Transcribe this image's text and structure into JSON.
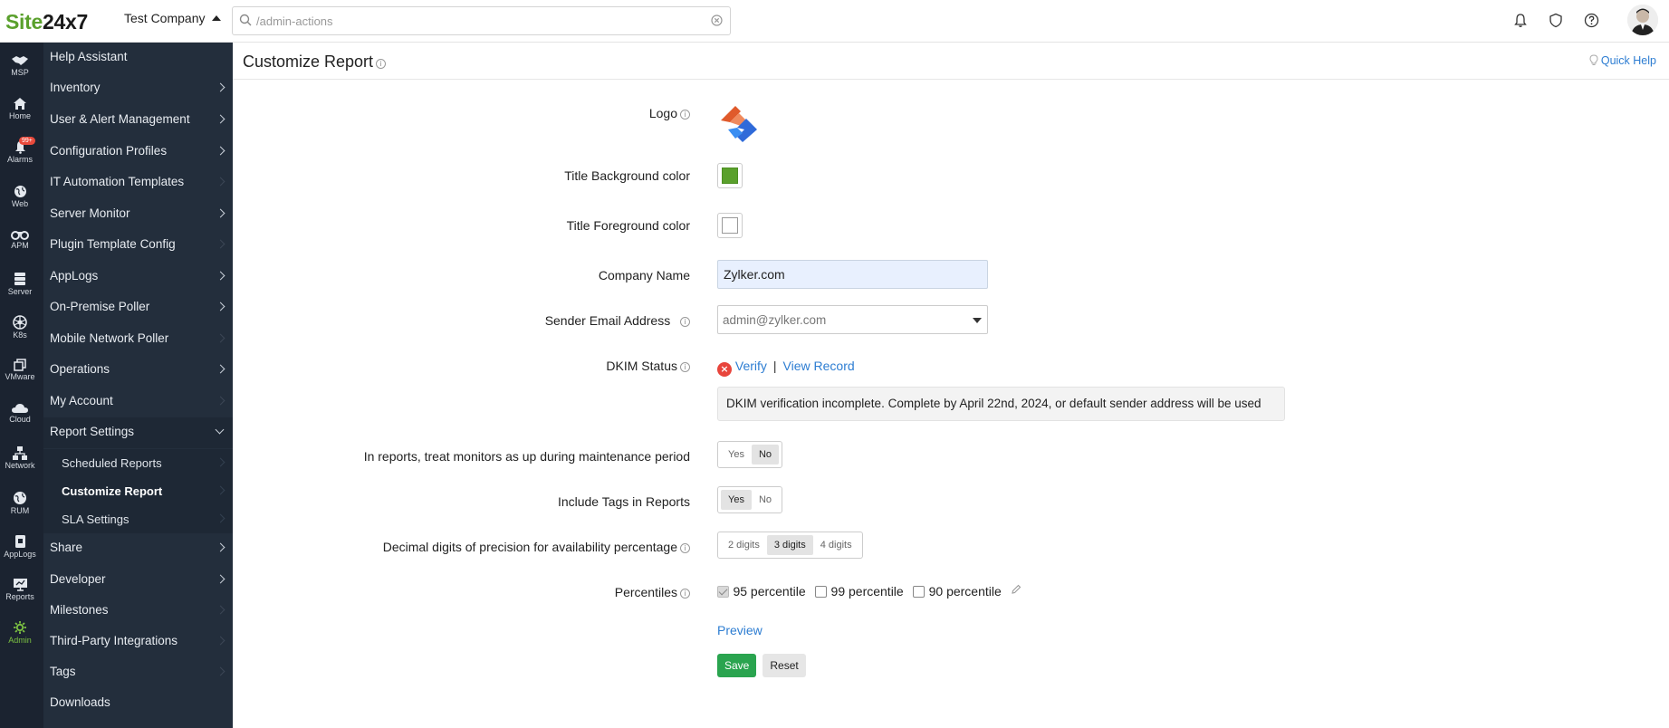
{
  "brand": {
    "part1": "Site",
    "part2": "24x7"
  },
  "company": "Test Company",
  "search": {
    "value": "/admin-actions",
    "placeholder": ""
  },
  "rail": [
    {
      "label": "MSP"
    },
    {
      "label": "Home"
    },
    {
      "label": "Alarms",
      "badge": "99+"
    },
    {
      "label": "Web"
    },
    {
      "label": "APM"
    },
    {
      "label": "Server"
    },
    {
      "label": "K8s"
    },
    {
      "label": "VMware"
    },
    {
      "label": "Cloud"
    },
    {
      "label": "Network"
    },
    {
      "label": "RUM"
    },
    {
      "label": "AppLogs"
    },
    {
      "label": "Reports"
    },
    {
      "label": "Admin"
    }
  ],
  "menu": [
    {
      "label": "Help Assistant"
    },
    {
      "label": "Inventory"
    },
    {
      "label": "User & Alert Management"
    },
    {
      "label": "Configuration Profiles"
    },
    {
      "label": "IT Automation Templates"
    },
    {
      "label": "Server Monitor"
    },
    {
      "label": "Plugin Template Config"
    },
    {
      "label": "AppLogs"
    },
    {
      "label": "On-Premise Poller"
    },
    {
      "label": "Mobile Network Poller"
    },
    {
      "label": "Operations"
    },
    {
      "label": "My Account"
    },
    {
      "label": "Report Settings"
    },
    {
      "label": "Share"
    },
    {
      "label": "Developer"
    },
    {
      "label": "Milestones"
    },
    {
      "label": "Third-Party Integrations"
    },
    {
      "label": "Tags"
    },
    {
      "label": "Downloads"
    }
  ],
  "submenu": [
    {
      "label": "Scheduled Reports"
    },
    {
      "label": "Customize Report"
    },
    {
      "label": "SLA Settings"
    }
  ],
  "page": {
    "title": "Customize Report",
    "quick_help": "Quick Help"
  },
  "form": {
    "logo_label": "Logo",
    "title_bg_label": "Title Background color",
    "title_bg_color": "#5aa02c",
    "title_fg_label": "Title Foreground color",
    "title_fg_color": "#ffffff",
    "company_label": "Company Name",
    "company_value": "Zylker.com",
    "sender_label": "Sender Email Address",
    "sender_value": "admin@zylker.com",
    "dkim_label": "DKIM Status",
    "dkim_verify": "Verify",
    "dkim_sep": "|",
    "dkim_view": "View Record",
    "dkim_note": "DKIM verification incomplete. Complete by April 22nd, 2024, or default sender address will be used",
    "maint_label": "In reports, treat monitors as up during maintenance period",
    "maint_yes": "Yes",
    "maint_no": "No",
    "tags_label": "Include Tags in Reports",
    "tags_yes": "Yes",
    "tags_no": "No",
    "decimal_label": "Decimal digits of precision for availability percentage",
    "decimal_options": [
      "2 digits",
      "3 digits",
      "4 digits"
    ],
    "percentiles_label": "Percentiles",
    "percentiles": [
      {
        "label": "95 percentile",
        "checked": true
      },
      {
        "label": "99 percentile",
        "checked": false
      },
      {
        "label": "90 percentile",
        "checked": false
      }
    ],
    "preview": "Preview",
    "save": "Save",
    "reset": "Reset"
  },
  "colors": {
    "accent": "#2d7dd2",
    "save": "#2aa44f",
    "brand_green": "#5aa02c",
    "sidebar": "#232e3c",
    "rail": "#1b2330"
  }
}
